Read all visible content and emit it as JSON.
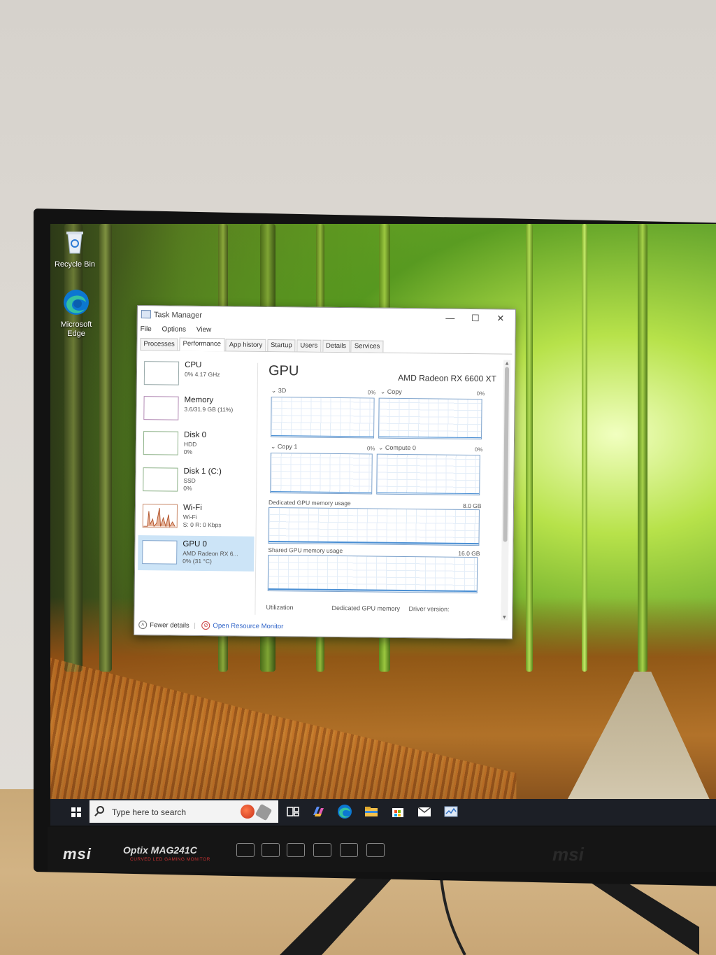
{
  "desktop": {
    "icons": [
      {
        "label": "Recycle Bin"
      },
      {
        "label": "Microsoft Edge"
      }
    ]
  },
  "task_manager": {
    "title": "Task Manager",
    "menu": [
      "File",
      "Options",
      "View"
    ],
    "tabs": [
      "Processes",
      "Performance",
      "App history",
      "Startup",
      "Users",
      "Details",
      "Services"
    ],
    "active_tab": "Performance",
    "devices": [
      {
        "name": "CPU",
        "sub1": "0% 4.17 GHz",
        "sub2": ""
      },
      {
        "name": "Memory",
        "sub1": "3.6/31.9 GB (11%)",
        "sub2": ""
      },
      {
        "name": "Disk 0",
        "sub1": "HDD",
        "sub2": "0%"
      },
      {
        "name": "Disk 1 (C:)",
        "sub1": "SSD",
        "sub2": "0%"
      },
      {
        "name": "Wi-Fi",
        "sub1": "Wi-Fi",
        "sub2": "S: 0 R: 0 Kbps"
      },
      {
        "name": "GPU 0",
        "sub1": "AMD Radeon RX 6...",
        "sub2": "0% (31 °C)"
      }
    ],
    "gpu": {
      "heading": "GPU",
      "model": "AMD Radeon RX 6600 XT",
      "engines": [
        {
          "label": "3D",
          "pct": "0%"
        },
        {
          "label": "Copy",
          "pct": "0%"
        },
        {
          "label": "Copy 1",
          "pct": "0%"
        },
        {
          "label": "Compute 0",
          "pct": "0%"
        }
      ],
      "dedicated_label": "Dedicated GPU memory usage",
      "dedicated_max": "8.0 GB",
      "shared_label": "Shared GPU memory usage",
      "shared_max": "16.0 GB",
      "bottom": [
        "Utilization",
        "Dedicated GPU memory",
        "Driver version:"
      ]
    },
    "footer": {
      "fewer": "Fewer details",
      "resource_monitor": "Open Resource Monitor"
    }
  },
  "taskbar": {
    "search_placeholder": "Type here to search"
  },
  "monitor": {
    "brand": "msi",
    "model": "Optix MAG241C",
    "subtitle": "CURVED LED GAMING MONITOR"
  }
}
